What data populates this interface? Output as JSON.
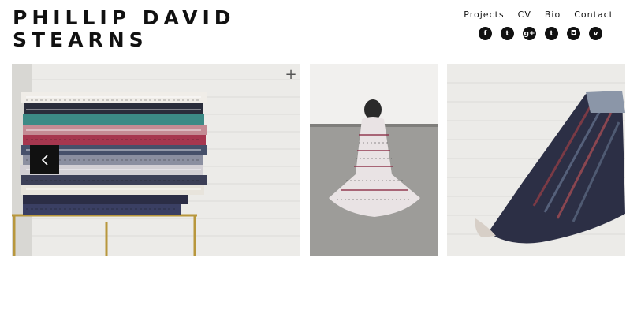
{
  "site": {
    "title_line1": "PHILLIP DAVID",
    "title_line2": "STEARNS"
  },
  "nav": {
    "items": [
      {
        "label": "Projects",
        "active": true
      },
      {
        "label": "CV",
        "active": false
      },
      {
        "label": "Bio",
        "active": false
      },
      {
        "label": "Contact",
        "active": false
      }
    ]
  },
  "social": [
    {
      "icon": "facebook-icon",
      "glyph": "f"
    },
    {
      "icon": "twitter-icon",
      "glyph": "t"
    },
    {
      "icon": "google-plus-icon",
      "glyph": "g+"
    },
    {
      "icon": "tumblr-icon",
      "glyph": "t"
    },
    {
      "icon": "instagram-icon",
      "glyph": "◘"
    },
    {
      "icon": "vimeo-icon",
      "glyph": "v"
    }
  ],
  "gallery": {
    "expand_glyph": "+",
    "prev_glyph": "‹",
    "images": [
      {
        "subject": "stack-of-woven-blankets"
      },
      {
        "subject": "person-wrapped-in-blanket"
      },
      {
        "subject": "person-with-striped-blanket"
      }
    ]
  }
}
